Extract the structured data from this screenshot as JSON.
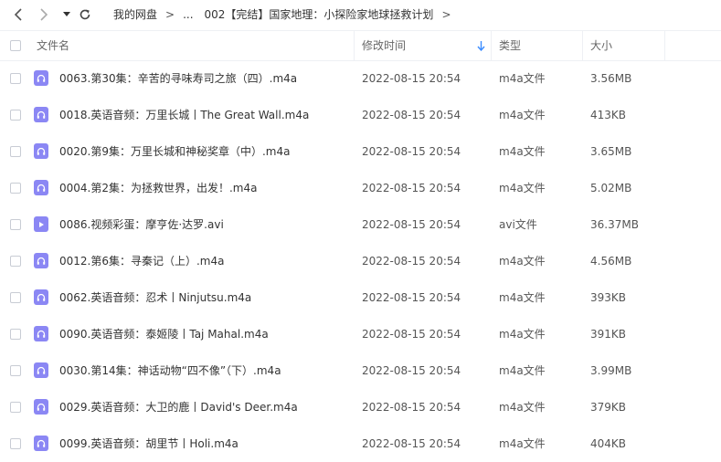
{
  "toolbar": {
    "back_icon": "chevron-left-icon",
    "forward_icon": "chevron-right-icon",
    "history_icon": "caret-down-icon",
    "refresh_icon": "refresh-icon"
  },
  "breadcrumb": {
    "root": "我的网盘",
    "ellipsis": "...",
    "current": "002【完结】国家地理：小探险家地球拯救计划",
    "separator": ">"
  },
  "columns": {
    "name": "文件名",
    "modified": "修改时间",
    "type": "类型",
    "size": "大小",
    "sort_icon": "arrow-down-icon",
    "accent": "#3b8cff"
  },
  "files": [
    {
      "name": "0063.第30集：辛苦的寻味寿司之旅（四）.m4a",
      "modified": "2022-08-15 20:54",
      "type": "m4a文件",
      "size": "3.56MB",
      "icon": "headphones-icon"
    },
    {
      "name": "0018.英语音频：万里长城丨The Great Wall.m4a",
      "modified": "2022-08-15 20:54",
      "type": "m4a文件",
      "size": "413KB",
      "icon": "headphones-icon"
    },
    {
      "name": "0020.第9集：万里长城和神秘奖章（中）.m4a",
      "modified": "2022-08-15 20:54",
      "type": "m4a文件",
      "size": "3.65MB",
      "icon": "headphones-icon"
    },
    {
      "name": "0004.第2集：为拯救世界，出发！.m4a",
      "modified": "2022-08-15 20:54",
      "type": "m4a文件",
      "size": "5.02MB",
      "icon": "headphones-icon"
    },
    {
      "name": "0086.视频彩蛋：摩亨佐·达罗.avi",
      "modified": "2022-08-15 20:54",
      "type": "avi文件",
      "size": "36.37MB",
      "icon": "play-icon"
    },
    {
      "name": "0012.第6集：寻秦记（上）.m4a",
      "modified": "2022-08-15 20:54",
      "type": "m4a文件",
      "size": "4.56MB",
      "icon": "headphones-icon"
    },
    {
      "name": "0062.英语音频：忍术丨Ninjutsu.m4a",
      "modified": "2022-08-15 20:54",
      "type": "m4a文件",
      "size": "393KB",
      "icon": "headphones-icon"
    },
    {
      "name": "0090.英语音频：泰姬陵丨Taj Mahal.m4a",
      "modified": "2022-08-15 20:54",
      "type": "m4a文件",
      "size": "391KB",
      "icon": "headphones-icon"
    },
    {
      "name": "0030.第14集：神话动物“四不像”（下）.m4a",
      "modified": "2022-08-15 20:54",
      "type": "m4a文件",
      "size": "3.99MB",
      "icon": "headphones-icon"
    },
    {
      "name": "0029.英语音频：大卫的鹿丨David's Deer.m4a",
      "modified": "2022-08-15 20:54",
      "type": "m4a文件",
      "size": "379KB",
      "icon": "headphones-icon"
    },
    {
      "name": "0099.英语音频：胡里节丨Holi.m4a",
      "modified": "2022-08-15 20:54",
      "type": "m4a文件",
      "size": "404KB",
      "icon": "headphones-icon"
    }
  ]
}
